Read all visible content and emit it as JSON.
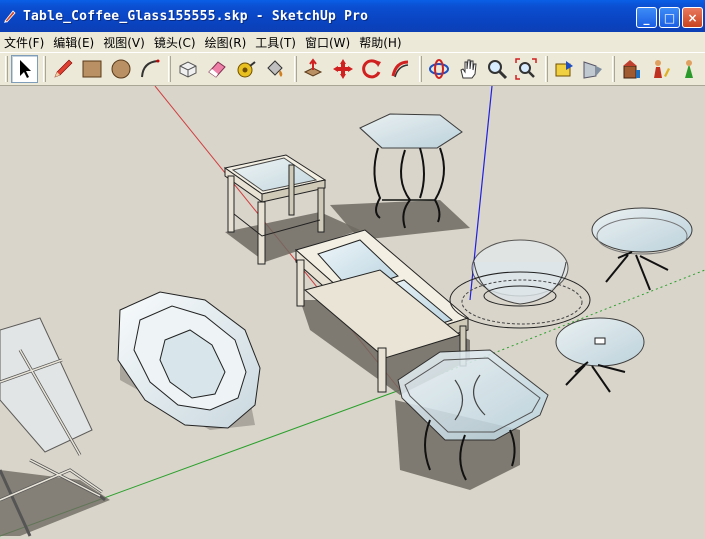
{
  "window": {
    "title": "Table_Coffee_Glass155555.skp - SketchUp Pro",
    "minimize_label": "_",
    "maximize_label": "□",
    "close_label": "×"
  },
  "menu": {
    "items": [
      {
        "label": "文件(F)"
      },
      {
        "label": "编辑(E)"
      },
      {
        "label": "视图(V)"
      },
      {
        "label": "镜头(C)"
      },
      {
        "label": "绘图(R)"
      },
      {
        "label": "工具(T)"
      },
      {
        "label": "窗口(W)"
      },
      {
        "label": "帮助(H)"
      }
    ]
  },
  "toolbar": {
    "tools": [
      {
        "name": "select-tool",
        "icon": "arrow-cursor-icon"
      },
      {
        "name": "line-tool",
        "icon": "pencil-icon"
      },
      {
        "name": "rectangle-tool",
        "icon": "rectangle-icon"
      },
      {
        "name": "circle-tool",
        "icon": "circle-icon"
      },
      {
        "name": "arc-tool",
        "icon": "arc-icon"
      },
      {
        "name": "make-component-tool",
        "icon": "component-icon"
      },
      {
        "name": "eraser-tool",
        "icon": "eraser-icon"
      },
      {
        "name": "tape-measure-tool",
        "icon": "tape-measure-icon"
      },
      {
        "name": "paint-bucket-tool",
        "icon": "paint-bucket-icon"
      },
      {
        "name": "push-pull-tool",
        "icon": "push-pull-icon"
      },
      {
        "name": "move-tool",
        "icon": "move-icon"
      },
      {
        "name": "rotate-tool",
        "icon": "rotate-icon"
      },
      {
        "name": "follow-me-tool",
        "icon": "follow-me-icon"
      },
      {
        "name": "orbit-tool",
        "icon": "orbit-icon"
      },
      {
        "name": "pan-tool",
        "icon": "hand-icon"
      },
      {
        "name": "zoom-tool",
        "icon": "magnifier-icon"
      },
      {
        "name": "zoom-extents-tool",
        "icon": "zoom-extents-icon"
      },
      {
        "name": "previous-view-tool",
        "icon": "previous-view-icon"
      },
      {
        "name": "next-view-tool",
        "icon": "next-view-icon"
      },
      {
        "name": "warehouse-tool",
        "icon": "warehouse-icon"
      },
      {
        "name": "components-tool",
        "icon": "components-icon"
      },
      {
        "name": "position-camera-tool",
        "icon": "position-camera-icon"
      }
    ],
    "colors": {
      "active_border": "#7f9db9",
      "bg": "#ece9d8"
    }
  },
  "scene": {
    "background": "#d9d5cb",
    "axis_red": "#d04040",
    "axis_green": "#2aa02a",
    "axis_blue": "#2020e0"
  }
}
